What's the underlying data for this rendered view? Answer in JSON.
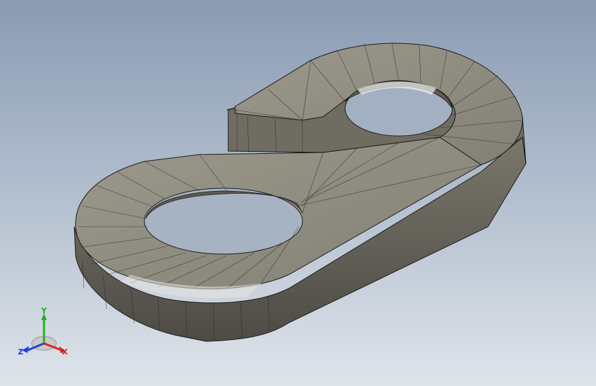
{
  "viewport": {
    "background_top": "#8a9bb2",
    "background_bottom": "#dfe4ea",
    "model_color": "#8f8c80",
    "edge_color": "#1a1a1a"
  },
  "triad": {
    "x_label": "X",
    "y_label": "Y",
    "z_label": "Z",
    "x_color": "#e02020",
    "y_color": "#20b020",
    "z_color": "#2040e0"
  }
}
